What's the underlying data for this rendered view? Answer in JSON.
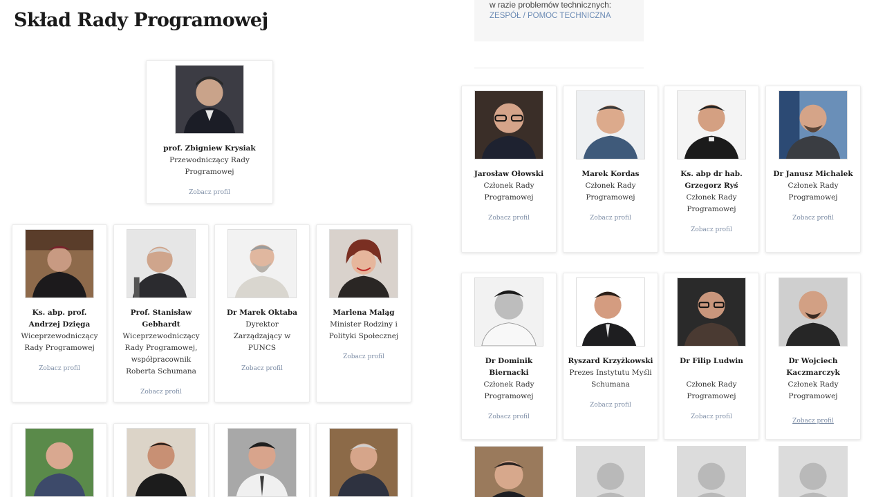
{
  "page_title": "Skład Rady Programowej",
  "help": {
    "text": "w razie problemów technicznych:",
    "team_link": "ZESPÓŁ",
    "separator": " / ",
    "support_link": "POMOC TECHNICZNA"
  },
  "profile_link_label": "Zobacz profil",
  "left_members": [
    {
      "name": "prof. Zbigniew Krysiak",
      "role": "Przewodniczący Rady Programowej",
      "photo": "portrait-dark-suit"
    },
    {
      "name": "Ks. abp. prof. Andrzej Dzięga",
      "role": "Wiceprzewodniczący Rady Programowej",
      "photo": "portrait-clergy"
    },
    {
      "name": "Prof. Stanisław Gebhardt",
      "role": "Wiceprzewodniczący Rady Programowej, współpracownik Roberta Schumana",
      "photo": "portrait-elder"
    },
    {
      "name": "Dr Marek Oktaba",
      "role": "Dyrektor Zarządzający w PUNCS",
      "photo": "portrait-beard"
    },
    {
      "name": "Marlena Maląg",
      "role": "Minister Rodziny i Polityki Społecznej",
      "photo": "portrait-woman"
    },
    {
      "name": "",
      "role": "",
      "photo": "portrait-outdoor"
    },
    {
      "name": "",
      "role": "",
      "photo": "portrait-clergy-2"
    },
    {
      "name": "",
      "role": "",
      "photo": "portrait-tie"
    },
    {
      "name": "",
      "role": "",
      "photo": "portrait-grey"
    }
  ],
  "right_members": [
    {
      "name": "Jarosław Ołowski",
      "role": "Członek Rady Programowej",
      "photo": "portrait-glasses"
    },
    {
      "name": "Marek Kordas",
      "role": "Członek Rady Programowej",
      "photo": "portrait-light"
    },
    {
      "name": "Ks. abp dr hab. Grzegorz Ryś",
      "role": "Członek Rady Programowej",
      "photo": "portrait-clergy-3"
    },
    {
      "name": "Dr Janusz Michalek",
      "role": "Członek Rady Programowej",
      "photo": "portrait-bald-glasses"
    },
    {
      "name": "Dr Dominik Biernacki",
      "role": "Członek Rady Programowej",
      "photo": "portrait-bw"
    },
    {
      "name": "Ryszard Krzyżkowski",
      "role": "Prezes Instytutu Myśli Schumana",
      "photo": "portrait-smile"
    },
    {
      "name": "Dr Filip Ludwin",
      "role": "Członek Rady Programowej",
      "photo": "portrait-dark-bg"
    },
    {
      "name": "Dr Wojciech Kaczmarczyk",
      "role": "Członek Rady Programowej",
      "photo": "portrait-bald"
    },
    {
      "name": "",
      "role": "",
      "photo": "portrait-young"
    },
    {
      "name": "",
      "role": "",
      "photo": "placeholder-avatar"
    },
    {
      "name": "",
      "role": "",
      "photo": "placeholder-avatar"
    },
    {
      "name": "",
      "role": "",
      "photo": "placeholder-avatar"
    }
  ],
  "colors": {
    "link": "#6d8cb5",
    "profile_link": "#7f8fa7",
    "help_bg": "#f6f6f6"
  }
}
